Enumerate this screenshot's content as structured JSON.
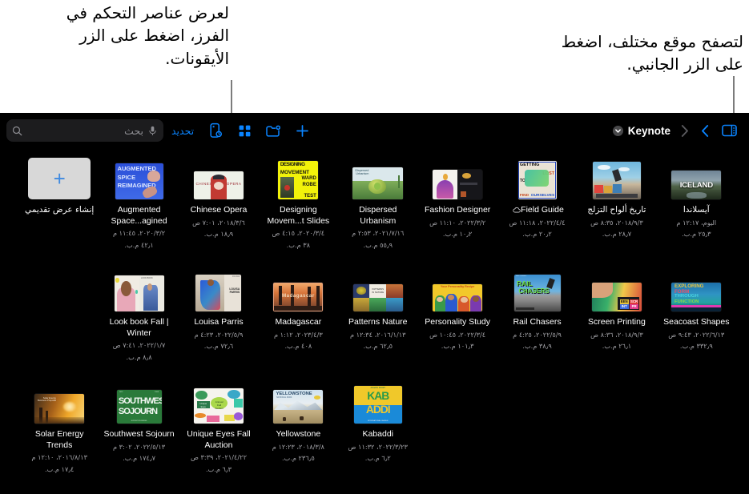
{
  "annotations": {
    "left": "لعرض عناصر التحكم في الفرز، اضغط على الزر الأيقونات.",
    "right": "لتصفح موقع مختلف، اضغط على الزر الجانبي."
  },
  "toolbar": {
    "search_placeholder": "بحث",
    "mic_icon": "microphone-icon",
    "search_icon": "search-icon",
    "select_label": "تحديد",
    "sort_icon": "sort-view-icon",
    "grid_icon": "grid-view-icon",
    "new_folder_icon": "new-folder-icon",
    "add_icon": "plus-icon",
    "app_name": "Keynote",
    "app_chevron_icon": "chevron-down-circle-icon",
    "back_icon": "chevron-back-icon",
    "forward_icon": "chevron-forward-icon",
    "sidebar_icon": "sidebar-toggle-icon",
    "accent_color": "#0a84ff"
  },
  "new_document": {
    "label": "إنشاء عرض تقديمي",
    "plus_icon": "plus-icon"
  },
  "documents": [
    {
      "title": "آيسلاندا",
      "rtl": true,
      "date": "اليوم، ١٢:١٧ م",
      "size": "٢٥٫٣ م.ب.",
      "cloud": false,
      "art": "iceland"
    },
    {
      "title": "تاريخ ألواح التزلج",
      "rtl": true,
      "date": "٢٠١٨/٩/٣، ٨:٣٥ ص",
      "size": "٢٨٫٧ م.ب.",
      "cloud": false,
      "art": "skate"
    },
    {
      "title": "Field Guide",
      "rtl": false,
      "date": "٢٠٢٢/٤/٤، ١١:١٨ ص",
      "size": "٢٠٫٢ م.ب.",
      "cloud": true,
      "art": "fieldguide"
    },
    {
      "title": "Fashion Designer",
      "rtl": false,
      "date": "٢٠٢٢/٣/٢، ١١:١٠ ص",
      "size": "١٠٫٢ م.ب.",
      "cloud": false,
      "art": "fashion"
    },
    {
      "title": "Dispersed Urbanism",
      "rtl": false,
      "date": "٢٠٢١/٧/١٦، ٢:٥٣ م",
      "size": "٥٥٫٩ م.ب.",
      "cloud": false,
      "art": "urbanism"
    },
    {
      "title": "Designing Movem...t Slides",
      "rtl": false,
      "date": "٢٠٢٠/٣/٤، ٤:١٥ ص",
      "size": "٣٨ م.ب.",
      "cloud": false,
      "art": "designing"
    },
    {
      "title": "Chinese Opera",
      "rtl": false,
      "date": "٢٠١٨/٣/٦، ٧:٠١ ص",
      "size": "١٨٫٩ م.ب.",
      "cloud": false,
      "art": "opera"
    },
    {
      "title": "Augmented Space...agined",
      "rtl": false,
      "date": "٢٠٢٠/٣/٢، ١١:٤٥ م",
      "size": "٤٢٫١ م.ب.",
      "cloud": false,
      "art": "augmented"
    },
    {
      "title": "Seacoast Shapes",
      "rtl": false,
      "date": "٢٠٢٢/٦/١٣، ٩:٤٣ ص",
      "size": "٣٣٢٫٩ م.ب.",
      "cloud": false,
      "art": "seacoast"
    },
    {
      "title": "Screen Printing",
      "rtl": false,
      "date": "٢٠١٨/٩/٣، ٨:٣٦ ص",
      "size": "٢٦٫١ م.ب.",
      "cloud": false,
      "art": "screenprint"
    },
    {
      "title": "Rail Chasers",
      "rtl": false,
      "date": "٢٠٢٢/٥/٩، ٤:٢٥ م",
      "size": "٣٨٫٩ م.ب.",
      "cloud": false,
      "art": "rail"
    },
    {
      "title": "Personality Study",
      "rtl": false,
      "date": "٢٠٢٢/٣/٤، ١٠:٤٥ ص",
      "size": "١٠١٫٣ م.ب.",
      "cloud": false,
      "art": "personality"
    },
    {
      "title": "Patterns Nature",
      "rtl": false,
      "date": "٢٠١٦/١/١٣، ١٢:٣٤ م",
      "size": "٦٢٫٥ م.ب.",
      "cloud": false,
      "art": "patterns"
    },
    {
      "title": "Madagascar",
      "rtl": false,
      "date": "٢٠٢٣/٤/٣، ١:١٢ م",
      "size": "٤٠٨ م.ب.",
      "cloud": false,
      "art": "madagascar"
    },
    {
      "title": "Louisa Parris",
      "rtl": false,
      "date": "٢٠٢٢/٥/٩، ٤:٢٣ م",
      "size": "٧٢٫٦ م.ب.",
      "cloud": false,
      "art": "louisa"
    },
    {
      "title": "Look book Fall | Winter",
      "rtl": false,
      "date": "٢٠٢٢/١/٧، ٧:٤١ ص",
      "size": "٨٫٨ م.ب.",
      "cloud": false,
      "art": "lookbook"
    },
    {
      "title": "Kabaddi",
      "rtl": false,
      "date": "٢٠٢٢/٣/٢٣، ١١:٣٢ ص",
      "size": "٦٫٢ م.ب.",
      "cloud": false,
      "art": "kabaddi"
    },
    {
      "title": "Yellowstone",
      "rtl": false,
      "date": "٢٠١٨/٣/٨، ١٢:٢٣ م",
      "size": "٢٣٦٫٥ م.ب.",
      "cloud": false,
      "art": "yellowstone"
    },
    {
      "title": "Unique Eyes Fall Auction",
      "rtl": false,
      "date": "٢٠٢١/٤/٢٢، ٣:٣٩ ص",
      "size": "٦٫٣ م.ب.",
      "cloud": false,
      "art": "uniqueeyes"
    },
    {
      "title": "Southwest Sojourn",
      "rtl": false,
      "date": "٢٠٢٢/٥/١٣، ٣:٠٢ م",
      "size": "١٧٤٫٧ م.ب.",
      "cloud": false,
      "art": "southwest"
    },
    {
      "title": "Solar Energy Trends",
      "rtl": false,
      "date": "٢٠١٦/٨/١٣، ١٢:١٠ م",
      "size": "١٧٫٤ م.ب.",
      "cloud": false,
      "art": "solar"
    }
  ]
}
